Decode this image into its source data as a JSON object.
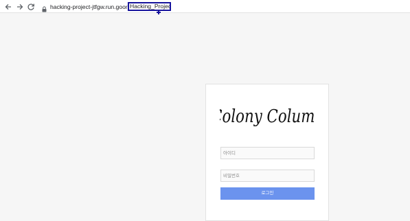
{
  "browser": {
    "url_host": "hacking-project-jtfgw.run.goorm.io/",
    "url_path_selected": "Hacking_Project/",
    "icons": {
      "back": "back-arrow-icon",
      "forward": "forward-arrow-icon",
      "reload": "reload-icon",
      "lock": "lock-icon"
    },
    "selection_color": "#16139c"
  },
  "login": {
    "logo_text": "Colony Column",
    "id_placeholder": "아이디",
    "password_placeholder": "비밀번호",
    "submit_label": "로그인",
    "button_color": "#6b93ee"
  }
}
